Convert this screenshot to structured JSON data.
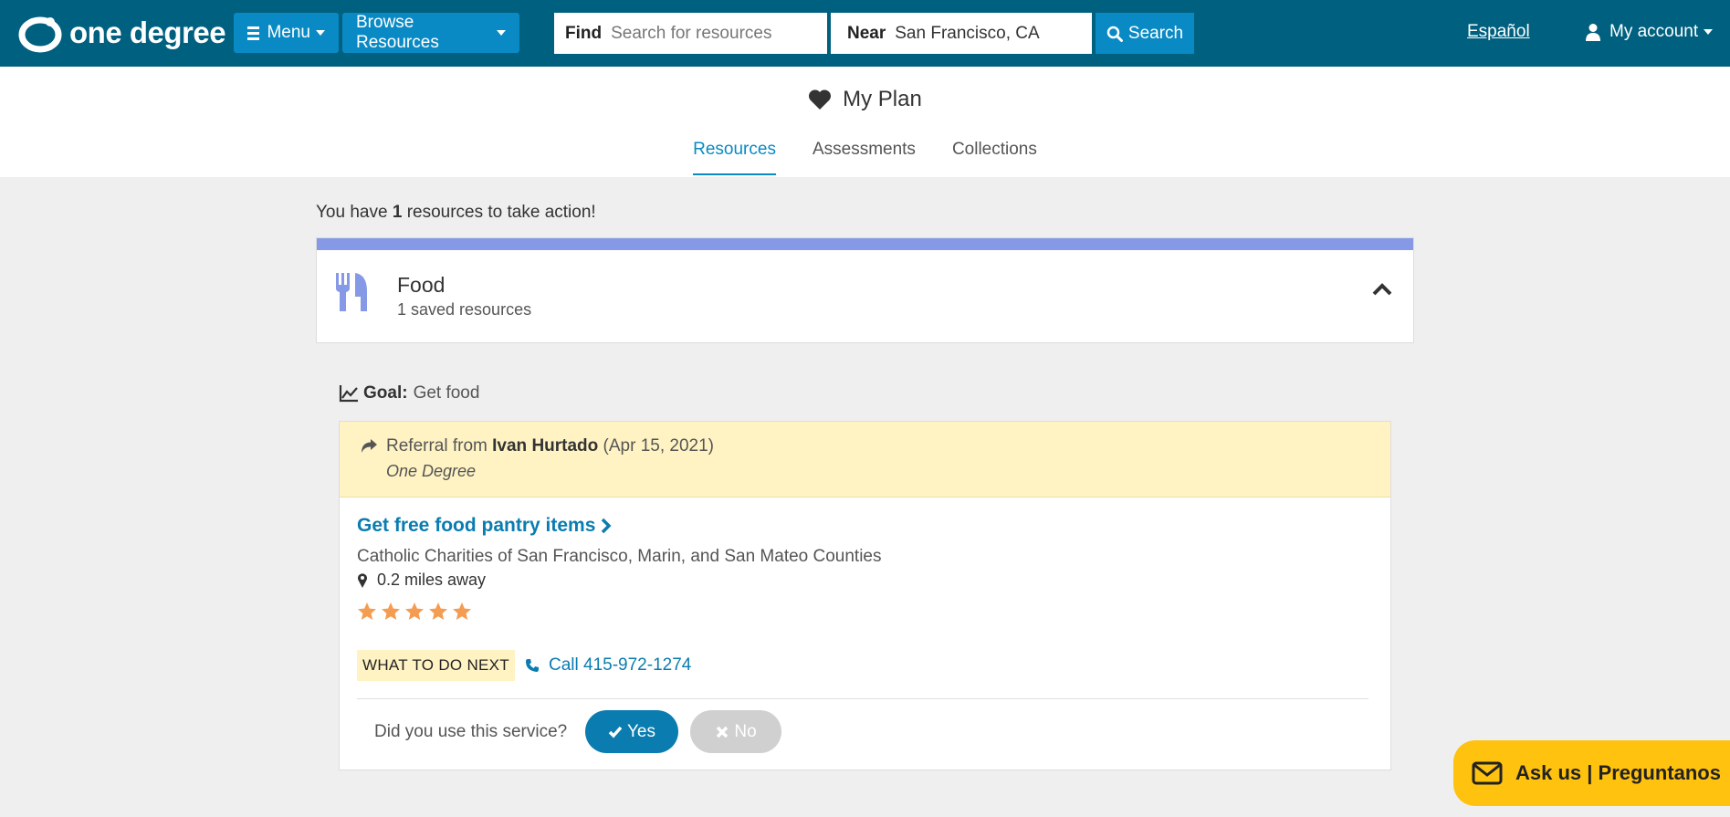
{
  "header": {
    "logo_text": "one degree",
    "menu_label": "Menu",
    "browse_label": "Browse Resources",
    "find_label": "Find",
    "find_placeholder": "Search for resources",
    "near_label": "Near",
    "near_value": "San Francisco, CA",
    "search_label": "Search",
    "language_link": "Español",
    "account_label": "My account"
  },
  "page": {
    "title": "My Plan",
    "tabs": [
      {
        "label": "Resources",
        "active": true
      },
      {
        "label": "Assessments",
        "active": false
      },
      {
        "label": "Collections",
        "active": false
      }
    ]
  },
  "summary": {
    "prefix": "You have",
    "count": "1",
    "suffix": "resources to take action!"
  },
  "category": {
    "name": "Food",
    "count_text": "1 saved resources",
    "accent_color": "#8599e6"
  },
  "goal": {
    "label": "Goal:",
    "text": "Get food"
  },
  "resource": {
    "referral_prefix": "Referral from",
    "referrer": "Ivan Hurtado",
    "referral_date": "(Apr 15, 2021)",
    "referral_org": "One Degree",
    "title": "Get free food pantry items",
    "provider": "Catholic Charities of San Francisco, Marin, and San Mateo Counties",
    "distance": "0.2 miles away",
    "rating": 5,
    "next_label": "WHAT TO DO NEXT",
    "call_text": "Call 415-972-1274",
    "question": "Did you use this service?",
    "yes_label": "Yes",
    "no_label": "No"
  },
  "help": {
    "label": "Ask us | Preguntanos"
  },
  "colors": {
    "header": "#00607f",
    "accent": "#0a8ac4",
    "link": "#0a7cb0",
    "referral_bg": "#fff3c4",
    "help_bg": "#ffc20e",
    "star": "#f49d52"
  }
}
